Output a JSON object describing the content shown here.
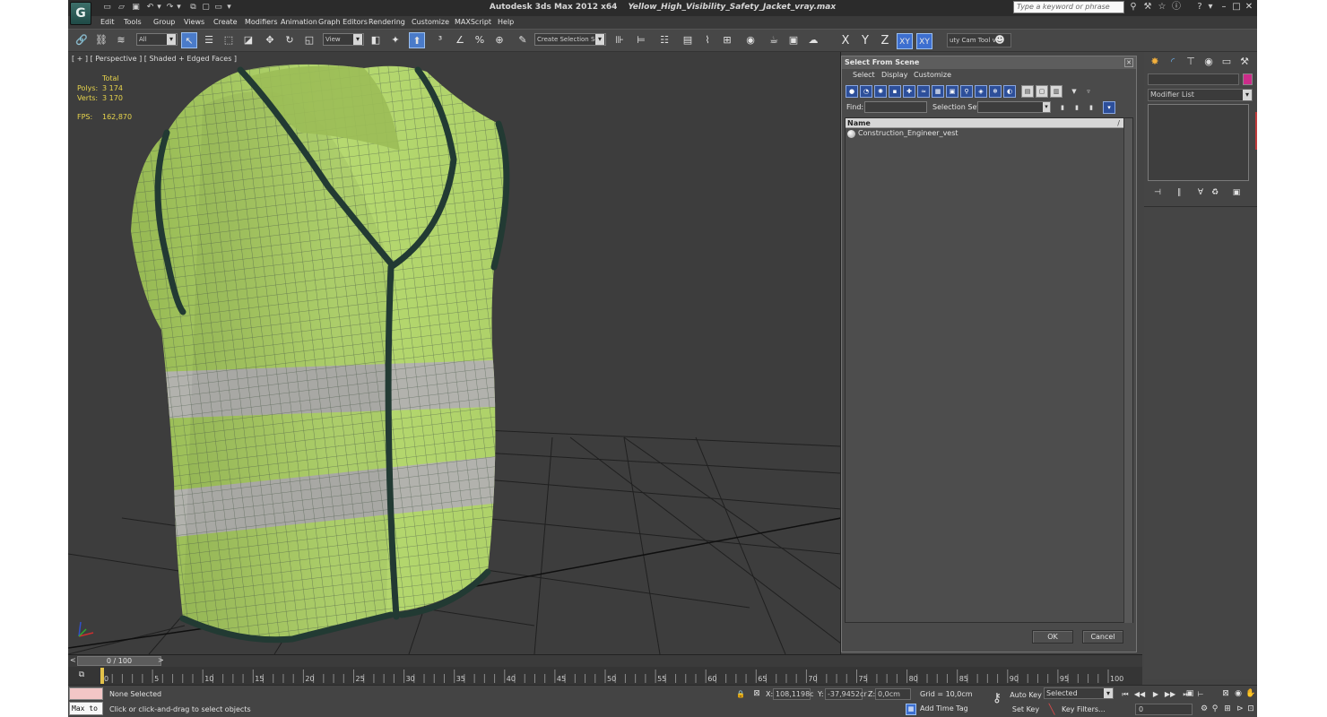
{
  "window": {
    "app_title": "Autodesk 3ds Max  2012 x64",
    "file_name": "Yellow_High_Visibility_Safety_Jacket_vray.max",
    "logo_text": "G",
    "search_placeholder": "Type a keyword or phrase"
  },
  "menu": [
    "Edit",
    "Tools",
    "Group",
    "Views",
    "Create",
    "Modifiers",
    "Animation",
    "Graph Editors",
    "Rendering",
    "Customize",
    "MAXScript",
    "Help"
  ],
  "toolbar": {
    "selection_filter": "All",
    "ref_coord_system": "View",
    "named_selection_set": "Create Selection Set",
    "axes": [
      "X",
      "Y",
      "Z",
      "XY",
      "XY"
    ],
    "extra_tool": "uty Cam Tool v"
  },
  "viewport": {
    "label": "[ + ] [ Perspective ] [ Shaded + Edged Faces ]",
    "stats_header": "Total",
    "polys_label": "Polys:",
    "polys_value": "3 174",
    "verts_label": "Verts:",
    "verts_value": "3 170",
    "fps_label": "FPS:",
    "fps_value": "162,870"
  },
  "select_from_scene": {
    "title": "Select From Scene",
    "menu": [
      "Select",
      "Display",
      "Customize"
    ],
    "find_label": "Find:",
    "find_value": "",
    "selection_set_label": "Selection Set:",
    "selection_set_value": "",
    "column_name": "Name",
    "column_sort": "/",
    "objects": [
      "Construction_Engineer_vest"
    ],
    "ok_label": "OK",
    "cancel_label": "Cancel"
  },
  "command_panel": {
    "object_color": "#cc2c8a",
    "modifier_list": "Modifier List"
  },
  "timeline": {
    "slider_text": "0 / 100",
    "prev": "<",
    "next": ">",
    "ticks": [
      0,
      5,
      10,
      15,
      20,
      25,
      30,
      35,
      40,
      45,
      50,
      55,
      60,
      65,
      70,
      75,
      80,
      85,
      90,
      95,
      100
    ],
    "range": [
      0,
      100
    ],
    "current_frame": 0
  },
  "status": {
    "maxscript_listener": "Max to",
    "selection_status": "None Selected",
    "prompt": "Click or click-and-drag to select objects",
    "x_label": "X:",
    "x_value": "108,1198c",
    "y_label": "Y:",
    "y_value": "-37,9452cr",
    "z_label": "Z:",
    "z_value": "0,0cm",
    "grid": "Grid = 10,0cm",
    "add_time_tag": "Add Time Tag",
    "auto_key": "Auto Key",
    "set_key": "Set Key",
    "key_mode": "Selected",
    "key_filters": "Key Filters...",
    "frame": "0"
  }
}
